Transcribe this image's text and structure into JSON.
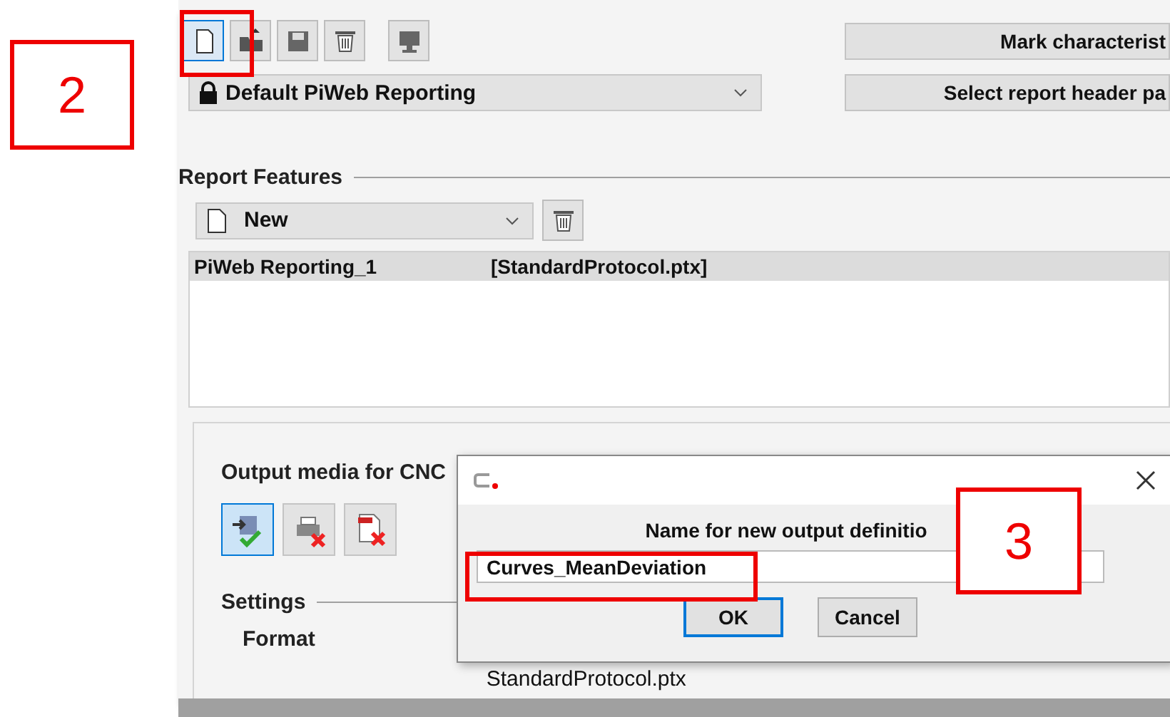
{
  "toolbar": {
    "buttons": [
      {
        "kind": "new",
        "selected": true
      },
      {
        "kind": "open",
        "selected": false
      },
      {
        "kind": "save",
        "selected": false
      },
      {
        "kind": "delete",
        "selected": false
      },
      {
        "kind": "screen",
        "selected": false
      }
    ]
  },
  "side_buttons": [
    "Mark characterist",
    "Select report header pa"
  ],
  "template_select": {
    "value": "Default PiWeb Reporting",
    "locked": true
  },
  "report_features": {
    "label": "Report Features",
    "select": {
      "value": "New"
    },
    "list": [
      {
        "name": "PiWeb Reporting_1",
        "file": "[StandardProtocol.ptx]",
        "selected": true
      }
    ]
  },
  "output_media": {
    "label": "Output media for CNC",
    "buttons": [
      {
        "kind": "file",
        "selected": true
      },
      {
        "kind": "printer",
        "selected": false
      },
      {
        "kind": "pdf",
        "selected": false
      }
    ]
  },
  "settings": {
    "label": "Settings",
    "format_label": "Format",
    "format_value": "StandardProtocol.ptx"
  },
  "dialog": {
    "prompt": "Name for new output definitio",
    "value": "Curves_MeanDeviation",
    "ok": "OK",
    "cancel": "Cancel"
  },
  "annotations": [
    {
      "label": "2"
    },
    {
      "label": "3"
    }
  ]
}
